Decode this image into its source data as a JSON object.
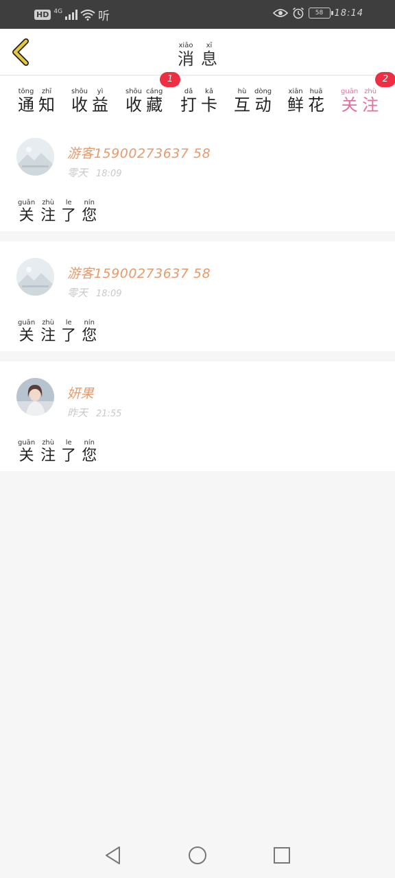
{
  "status_bar": {
    "hd": "HD",
    "network": "4G",
    "extra": "听",
    "battery": "58",
    "time": "18:14"
  },
  "header": {
    "title": [
      {
        "py": "xiāo",
        "hz": "消"
      },
      {
        "py": "xī",
        "hz": "息"
      }
    ]
  },
  "tabs": [
    {
      "chars": [
        {
          "py": "tōng",
          "hz": "通"
        },
        {
          "py": "zhī",
          "hz": "知"
        }
      ]
    },
    {
      "chars": [
        {
          "py": "shōu",
          "hz": "收"
        },
        {
          "py": "yì",
          "hz": "益"
        }
      ]
    },
    {
      "chars": [
        {
          "py": "shōu",
          "hz": "收"
        },
        {
          "py": "cáng",
          "hz": "藏"
        }
      ],
      "badge": "1"
    },
    {
      "chars": [
        {
          "py": "dǎ",
          "hz": "打"
        },
        {
          "py": "kǎ",
          "hz": "卡"
        }
      ]
    },
    {
      "chars": [
        {
          "py": "hù",
          "hz": "互"
        },
        {
          "py": "dòng",
          "hz": "动"
        }
      ]
    },
    {
      "chars": [
        {
          "py": "xiān",
          "hz": "鲜"
        },
        {
          "py": "huā",
          "hz": "花"
        }
      ]
    },
    {
      "chars": [
        {
          "py": "guān",
          "hz": "关"
        },
        {
          "py": "zhù",
          "hz": "注"
        }
      ],
      "badge": "2",
      "active": true
    }
  ],
  "messages": [
    {
      "username": "游客15900273637 58",
      "username_full": "游客15900273637 58",
      "level": "零天",
      "time": "18:09",
      "avatar": "placeholder-avatar",
      "content": [
        {
          "py": "guān",
          "hz": "关"
        },
        {
          "py": "zhù",
          "hz": "注"
        },
        {
          "py": "le",
          "hz": "了"
        },
        {
          "py": "nín",
          "hz": "您"
        }
      ]
    },
    {
      "username": "游客15900273637 58",
      "username_full": "游客15900273637 58",
      "level": "零天",
      "time": "18:09",
      "avatar": "placeholder-avatar",
      "content": [
        {
          "py": "guān",
          "hz": "关"
        },
        {
          "py": "zhù",
          "hz": "注"
        },
        {
          "py": "le",
          "hz": "了"
        },
        {
          "py": "nín",
          "hz": "您"
        }
      ]
    },
    {
      "username": "妍果",
      "username_full": "妍果",
      "level": "昨天",
      "time": "21:55",
      "avatar": "user-photo-avatar",
      "content": [
        {
          "py": "guān",
          "hz": "关"
        },
        {
          "py": "zhù",
          "hz": "注"
        },
        {
          "py": "le",
          "hz": "了"
        },
        {
          "py": "nín",
          "hz": "您"
        }
      ]
    }
  ],
  "nav_bar": {
    "icons": [
      "back-triangle-icon",
      "home-circle-icon",
      "recents-square-icon"
    ]
  },
  "colors": {
    "accent": "#e46d9e",
    "badge": "#ee2f43",
    "username": "#e79a6b",
    "back_arrow": "#e6c93a"
  }
}
